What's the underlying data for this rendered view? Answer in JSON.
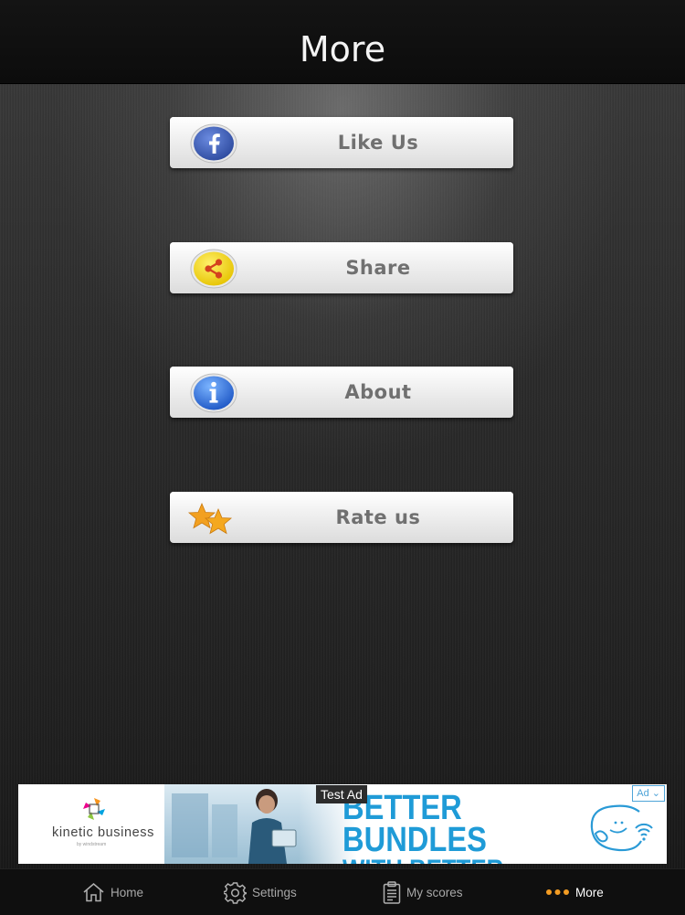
{
  "header": {
    "title": "More"
  },
  "menu": [
    {
      "label": "Like Us",
      "icon": "facebook-icon"
    },
    {
      "label": "Share",
      "icon": "share-icon"
    },
    {
      "label": "About",
      "icon": "info-icon"
    },
    {
      "label": "Rate us",
      "icon": "stars-icon"
    }
  ],
  "ad": {
    "test_label": "Test Ad",
    "badge": "Ad ⌄",
    "brand": "kinetic business",
    "brand_sub": "by windstream",
    "headline_line1": "BETTER BUNDLES",
    "headline_line2": "WITH BETTER FEATURES"
  },
  "tabs": [
    {
      "label": "Home",
      "icon": "home-icon"
    },
    {
      "label": "Settings",
      "icon": "gear-icon"
    },
    {
      "label": "My scores",
      "icon": "clipboard-icon"
    },
    {
      "label": "More",
      "icon": "more-dots-icon"
    }
  ],
  "colors": {
    "accent": "#f39c23",
    "facebook": "#3b5bb0",
    "share": "#f0d000",
    "info": "#2a6ed8",
    "star": "#f2a020",
    "ad_blue": "#1f9bd7"
  }
}
